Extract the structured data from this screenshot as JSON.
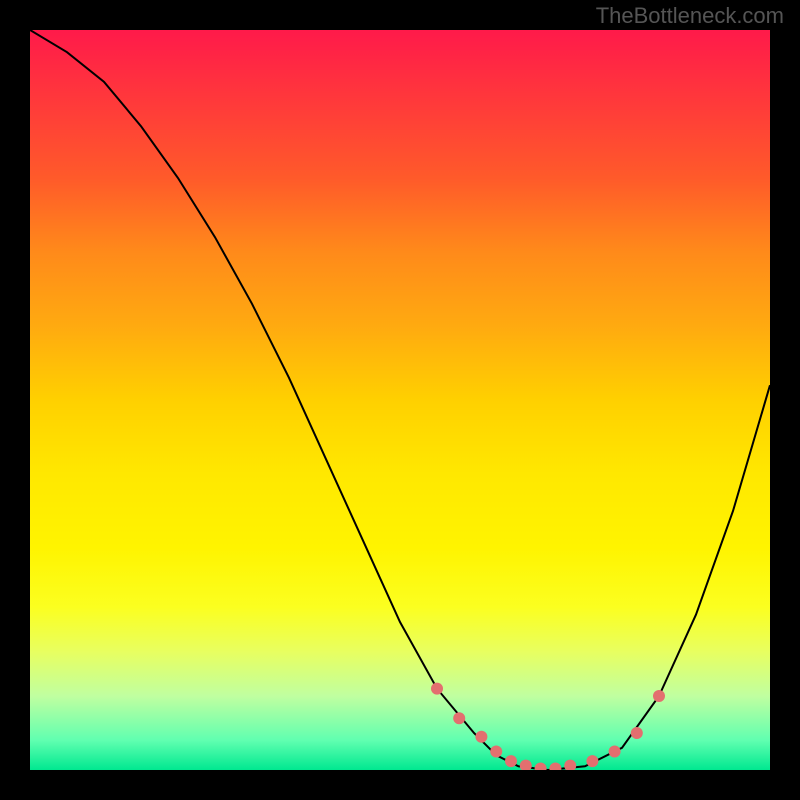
{
  "watermark": "TheBottleneck.com",
  "chart_data": {
    "type": "line",
    "title": "",
    "xlabel": "",
    "ylabel": "",
    "xlim": [
      0,
      100
    ],
    "ylim": [
      0,
      100
    ],
    "series": [
      {
        "name": "curve",
        "x": [
          0,
          5,
          10,
          15,
          20,
          25,
          30,
          35,
          40,
          45,
          50,
          55,
          60,
          63,
          66,
          70,
          75,
          80,
          85,
          90,
          95,
          100
        ],
        "y": [
          100,
          97,
          93,
          87,
          80,
          72,
          63,
          53,
          42,
          31,
          20,
          11,
          5,
          2,
          0.5,
          0,
          0.5,
          3,
          10,
          21,
          35,
          52
        ]
      }
    ],
    "markers": {
      "name": "highlight-points",
      "x": [
        55,
        58,
        61,
        63,
        65,
        67,
        69,
        71,
        73,
        76,
        79,
        82,
        85
      ],
      "y": [
        11,
        7,
        4.5,
        2.5,
        1.2,
        0.6,
        0.2,
        0.2,
        0.6,
        1.2,
        2.5,
        5,
        10
      ],
      "color": "#e36f6f",
      "radius": 6
    },
    "gradient_stops": [
      {
        "pos": 0,
        "color": "#ff1a4a"
      },
      {
        "pos": 50,
        "color": "#ffd000"
      },
      {
        "pos": 80,
        "color": "#f0ff40"
      },
      {
        "pos": 100,
        "color": "#00e890"
      }
    ]
  }
}
